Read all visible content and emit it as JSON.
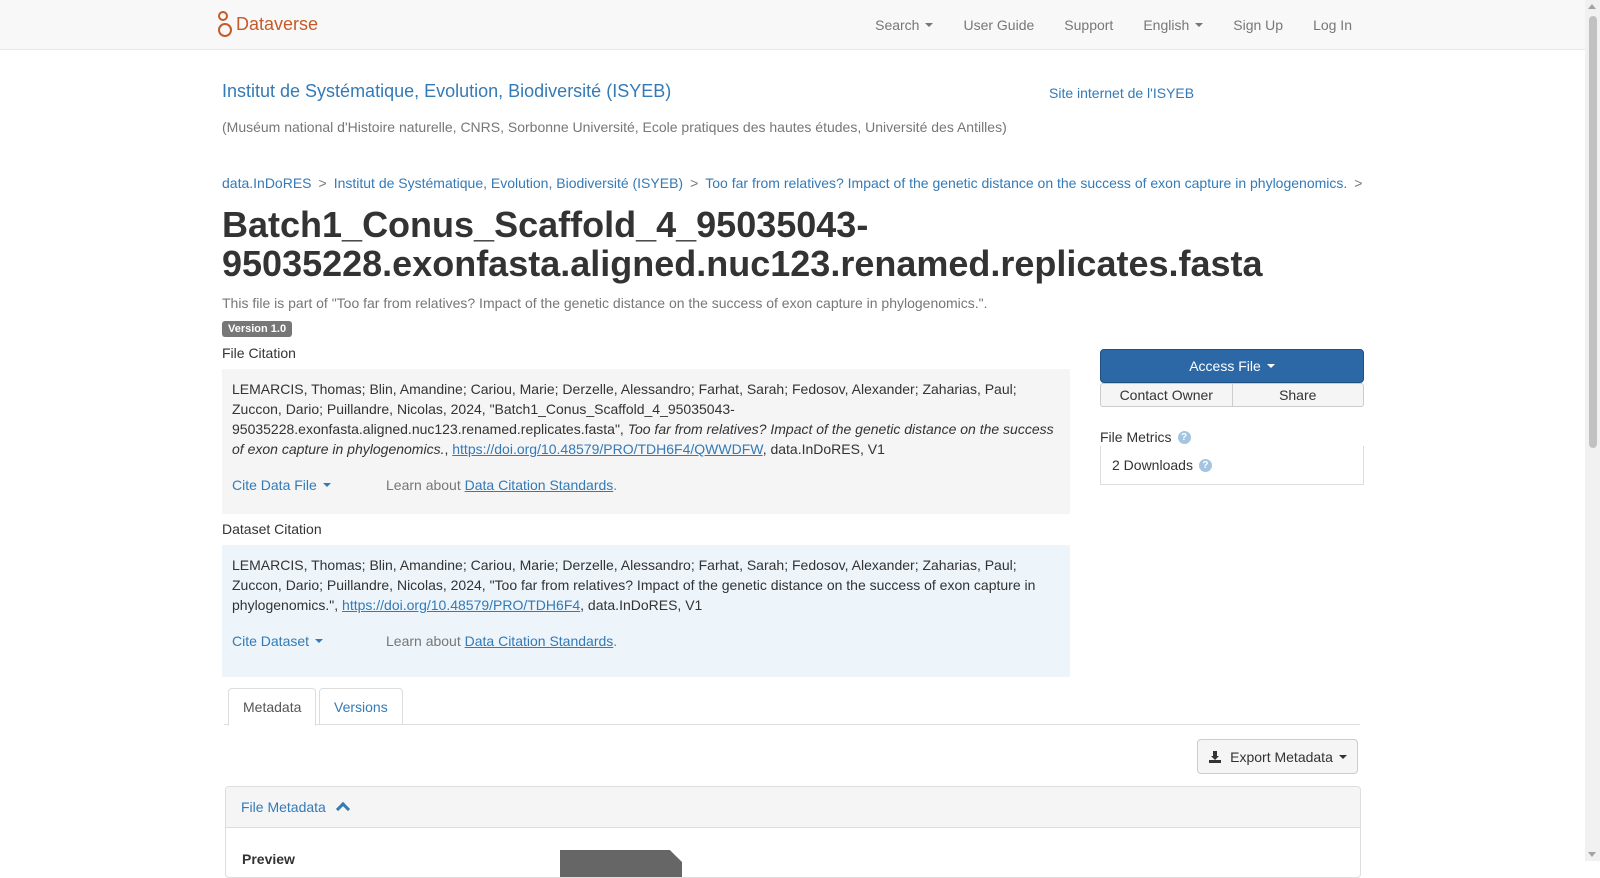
{
  "navbar": {
    "brand": "Dataverse",
    "items": [
      {
        "label": "Search",
        "dropdown": true
      },
      {
        "label": "User Guide",
        "dropdown": false
      },
      {
        "label": "Support",
        "dropdown": false
      },
      {
        "label": "English",
        "dropdown": true
      },
      {
        "label": "Sign Up",
        "dropdown": false
      },
      {
        "label": "Log In",
        "dropdown": false
      }
    ]
  },
  "header": {
    "dataverse_name": "Institut de Systématique, Evolution, Biodiversité (ISYEB)",
    "affiliation": "(Muséum national d'Histoire naturelle, CNRS, Sorbonne Université, Ecole pratiques des hautes études, Université des Antilles)",
    "site_link": "Site internet de l'ISYEB"
  },
  "breadcrumb": [
    "data.InDoRES",
    "Institut de Systématique, Evolution, Biodiversité (ISYEB)",
    "Too far from relatives? Impact of the genetic distance on the success of exon capture in phylogenomics."
  ],
  "breadcrumb_sep": ">",
  "file": {
    "title": "Batch1_Conus_Scaffold_4_95035043-95035228.exonfasta.aligned.nuc123.renamed.replicates.fasta",
    "part_of": "This file is part of \"Too far from relatives? Impact of the genetic distance on the success of exon capture in phylogenomics.\".",
    "version": "Version 1.0"
  },
  "file_citation": {
    "label": "File Citation",
    "text_before": "LEMARCIS, Thomas; Blin, Amandine; Cariou, Marie; Derzelle, Alessandro; Farhat, Sarah; Fedosov, Alexander; Zaharias, Paul; Zuccon, Dario; Puillandre, Nicolas, 2024, \"Batch1_Conus_Scaffold_4_95035043-95035228.exonfasta.aligned.nuc123.renamed.replicates.fasta\", ",
    "italic": "Too far from relatives? Impact of the genetic distance on the success of exon capture in phylogenomics.",
    "sep": ", ",
    "doi": "https://doi.org/10.48579/PRO/TDH6F4/QWWDFW",
    "text_after": ", data.InDoRES, V1",
    "cite_button": "Cite Data File",
    "learn_prefix": "Learn about ",
    "learn_link": "Data Citation Standards",
    "learn_suffix": "."
  },
  "dataset_citation": {
    "label": "Dataset Citation",
    "text_before": "LEMARCIS, Thomas; Blin, Amandine; Cariou, Marie; Derzelle, Alessandro; Farhat, Sarah; Fedosov, Alexander; Zaharias, Paul; Zuccon, Dario; Puillandre, Nicolas, 2024, \"Too far from relatives? Impact of the genetic distance on the success of exon capture in phylogenomics.\", ",
    "doi": "https://doi.org/10.48579/PRO/TDH6F4",
    "text_after": ", data.InDoRES, V1",
    "cite_button": "Cite Dataset",
    "learn_prefix": "Learn about ",
    "learn_link": "Data Citation Standards",
    "learn_suffix": "."
  },
  "actions": {
    "access_file": "Access File",
    "contact_owner": "Contact Owner",
    "share": "Share"
  },
  "metrics": {
    "label": "File Metrics",
    "downloads": "2 Downloads"
  },
  "tabs": [
    "Metadata",
    "Versions"
  ],
  "export_metadata": "Export Metadata",
  "file_metadata_panel": {
    "heading": "File Metadata",
    "preview_label": "Preview"
  },
  "colors": {
    "link": "#337ab7",
    "brand": "#c55b28",
    "primary_button": "#2c68a6",
    "dataset_citation_bg": "#edf4fa",
    "file_citation_bg": "#f5f5f5"
  }
}
